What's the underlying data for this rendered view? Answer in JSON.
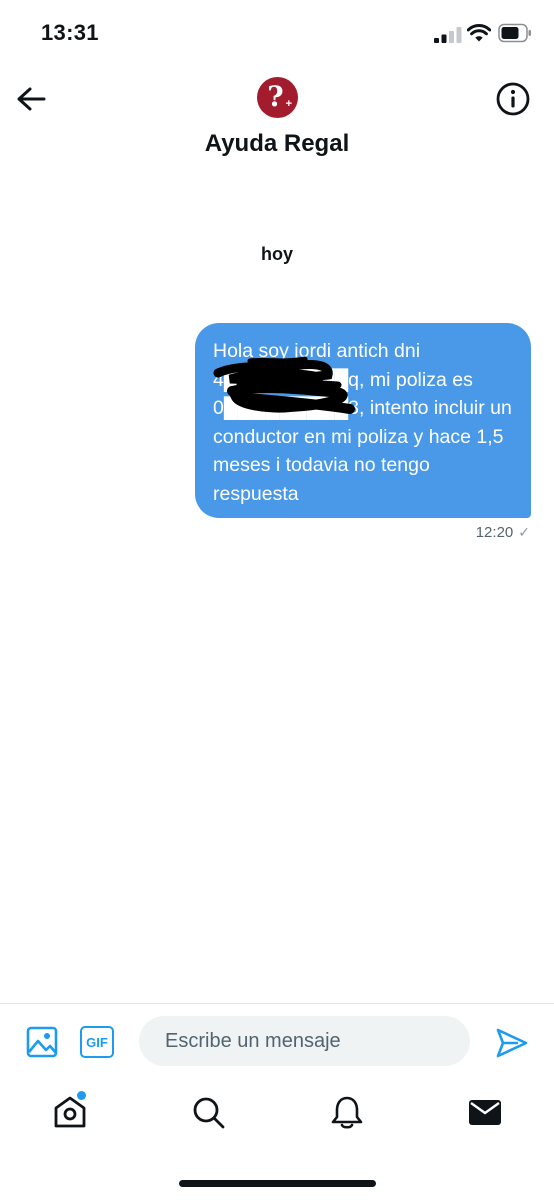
{
  "status_bar": {
    "time": "13:31"
  },
  "header": {
    "contact_name": "Ayuda Regal",
    "avatar_glyph": "?",
    "avatar_color": "#a21c2e"
  },
  "conversation": {
    "date_separator": "hoy",
    "messages": [
      {
        "text": "Hola soy jordi antich dni 4█████████q, mi poliza es 0█████████3, intento incluir un conductor en mi poliza y hace 1,5 meses i todavia no tengo respuesta",
        "time": "12:20",
        "status_glyph": "✓",
        "bubble_color": "#4a99e9"
      }
    ]
  },
  "compose": {
    "gif_label": "GIF",
    "placeholder": "Escribe un mensaje"
  },
  "icons": {
    "back": "arrow-left-icon",
    "info": "info-icon",
    "media": "image-icon",
    "send": "send-icon",
    "tabs": [
      "home-icon",
      "search-icon",
      "bell-icon",
      "mail-icon"
    ]
  },
  "colors": {
    "accent": "#1d9bf0",
    "text": "#0f1419",
    "secondary_text": "#536471"
  }
}
